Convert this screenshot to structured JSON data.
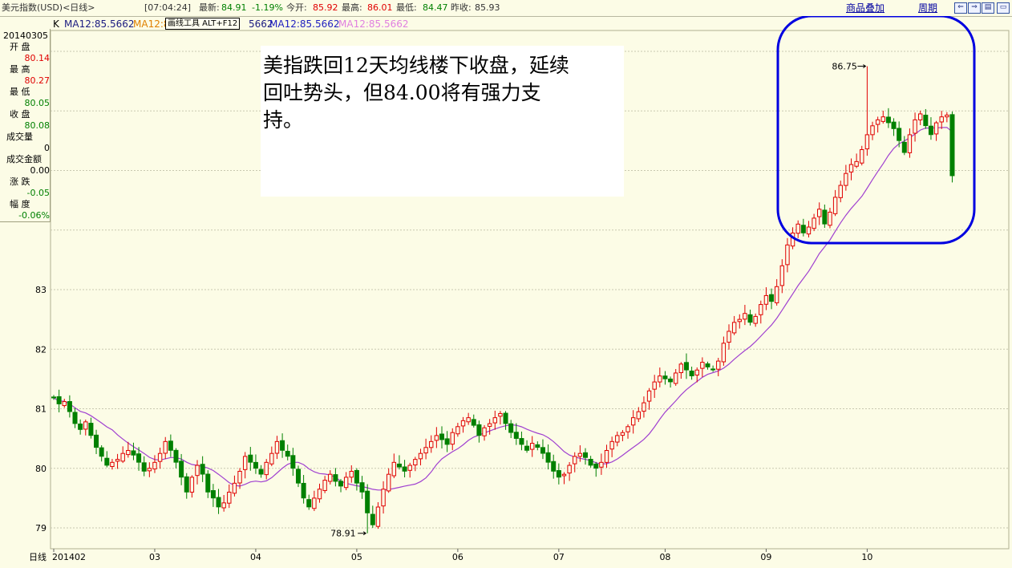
{
  "header": {
    "symbol": "美元指数(USD)<日线>",
    "time": "[07:04:24]",
    "latest_label": "最新:",
    "latest_value": "84.91",
    "change_pct": "-1.19%",
    "open_label": "今开:",
    "open_value": "85.92",
    "high_label": "最高:",
    "high_value": "86.01",
    "low_label": "最低:",
    "low_value": "84.47",
    "prev_label": "昨收:",
    "prev_value": "85.93",
    "overlay_link": "商品叠加",
    "period_link": "周期"
  },
  "window_buttons": [
    "⇐",
    "⇒",
    "▤",
    "▭"
  ],
  "ma_legend": {
    "k_label": "K",
    "item1": "MA12:85.5662",
    "item2": "MA12:8",
    "item3": "5662",
    "item4": "MA12:85.5662",
    "item5": "MA12:85.5662",
    "tooltip": "画线工具 ALT+F12",
    "colors": {
      "item1": "#1a1a80",
      "item2": "#e08000",
      "item4": "#2020c0",
      "item5": "#e080e0"
    }
  },
  "info": {
    "date": "20140305",
    "rows": [
      {
        "label": "开  盘",
        "value": "80.14",
        "color": "#e00000"
      },
      {
        "label": "最  高",
        "value": "80.27",
        "color": "#e00000"
      },
      {
        "label": "最  低",
        "value": "80.05",
        "color": "#008000"
      },
      {
        "label": "收  盘",
        "value": "80.08",
        "color": "#008000"
      },
      {
        "label": "成交量",
        "value": "0",
        "color": "#000000"
      },
      {
        "label": "成交金额",
        "value": "0.00",
        "color": "#000000"
      },
      {
        "label": "涨  跌",
        "value": "-0.05",
        "color": "#008000"
      },
      {
        "label": "幅  度",
        "value": "-0.06%",
        "color": "#008000"
      }
    ]
  },
  "annotation": {
    "lines": [
      "美指跌回12天均线楼下收盘，延续",
      "回吐势头，但84.00将有强力支",
      "持。"
    ]
  },
  "footer_label": "日线",
  "chart_data": {
    "type": "candlestick",
    "ylim": [
      78.65,
      87.35
    ],
    "y_ticks": [
      79,
      80,
      81,
      82,
      83
    ],
    "x_tick_labels": [
      {
        "label": "201402",
        "index": 0
      },
      {
        "label": "03",
        "index": 19
      },
      {
        "label": "04",
        "index": 38
      },
      {
        "label": "05",
        "index": 57
      },
      {
        "label": "06",
        "index": 76
      },
      {
        "label": "07",
        "index": 95
      },
      {
        "label": "08",
        "index": 115
      },
      {
        "label": "09",
        "index": 134
      },
      {
        "label": "10",
        "index": 153
      }
    ],
    "high_annotation": {
      "label": "86.75",
      "value": 86.75,
      "index": 153
    },
    "low_annotation": {
      "label": "78.91",
      "value": 78.91,
      "index": 59
    },
    "ma_series": {
      "name": "MA12",
      "color": "#a040d0"
    },
    "up_color": "#e00000",
    "down_color": "#008000",
    "highlight_ellipse_color": "#0000e0",
    "closes": [
      81.18,
      81.08,
      81.12,
      80.95,
      80.75,
      80.65,
      80.78,
      80.55,
      80.35,
      80.2,
      80.05,
      80.1,
      80.15,
      80.25,
      80.3,
      80.22,
      80.1,
      79.95,
      80.0,
      80.1,
      80.25,
      80.45,
      80.3,
      80.1,
      79.85,
      79.6,
      79.85,
      80.05,
      79.9,
      79.6,
      79.5,
      79.35,
      79.42,
      79.6,
      79.75,
      79.95,
      80.2,
      80.1,
      80.0,
      79.9,
      80.1,
      80.25,
      80.45,
      80.3,
      80.2,
      80.0,
      79.75,
      79.5,
      79.35,
      79.5,
      79.65,
      79.8,
      79.9,
      79.78,
      79.7,
      79.85,
      79.95,
      79.75,
      79.6,
      79.25,
      79.05,
      79.35,
      79.65,
      79.9,
      80.1,
      80.02,
      79.95,
      80.05,
      80.15,
      80.25,
      80.35,
      80.45,
      80.55,
      80.48,
      80.4,
      80.6,
      80.7,
      80.8,
      80.85,
      80.72,
      80.55,
      80.68,
      80.75,
      80.85,
      80.92,
      80.75,
      80.6,
      80.5,
      80.4,
      80.3,
      80.42,
      80.35,
      80.25,
      80.1,
      79.95,
      79.85,
      79.9,
      80.05,
      80.2,
      80.25,
      80.18,
      80.05,
      80.0,
      80.1,
      80.3,
      80.45,
      80.55,
      80.6,
      80.7,
      80.85,
      80.95,
      81.1,
      81.3,
      81.45,
      81.55,
      81.5,
      81.45,
      81.6,
      81.75,
      81.65,
      81.55,
      81.65,
      81.78,
      81.7,
      81.65,
      81.8,
      82.1,
      82.3,
      82.45,
      82.5,
      82.6,
      82.45,
      82.55,
      82.75,
      82.9,
      82.8,
      83.05,
      83.4,
      83.75,
      83.95,
      84.1,
      83.95,
      84.05,
      84.2,
      84.35,
      84.1,
      84.3,
      84.55,
      84.75,
      84.95,
      85.1,
      85.15,
      85.35,
      85.6,
      85.75,
      85.85,
      85.9,
      85.8,
      85.7,
      85.5,
      85.3,
      85.6,
      85.85,
      85.95,
      85.75,
      85.6,
      85.8,
      85.9,
      85.93,
      84.91
    ]
  }
}
